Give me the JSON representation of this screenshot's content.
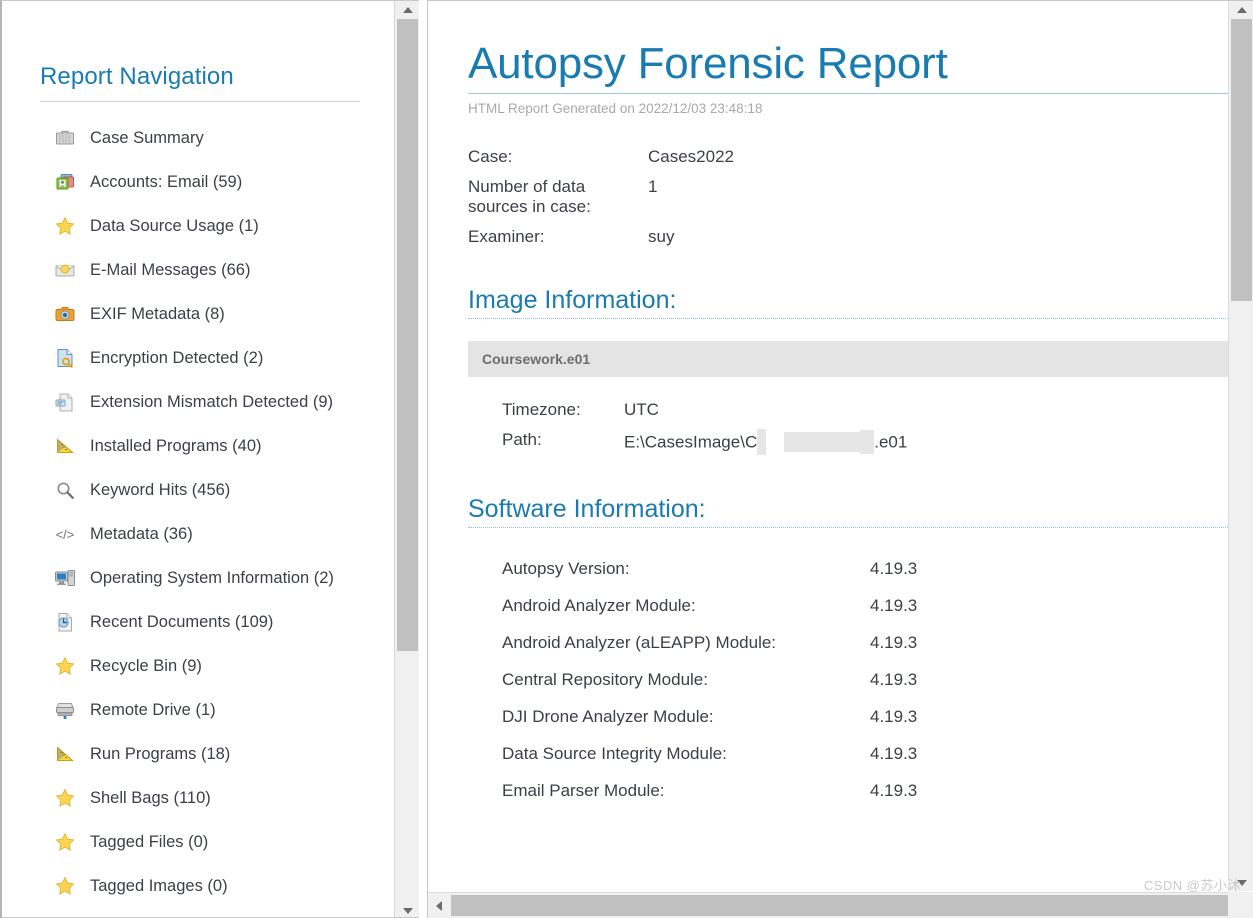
{
  "sidebar": {
    "title": "Report Navigation",
    "items": [
      {
        "label": "Case Summary",
        "icon": "briefcase-icon"
      },
      {
        "label": "Accounts: Email (59)",
        "icon": "accounts-cards-icon"
      },
      {
        "label": "Data Source Usage (1)",
        "icon": "star-icon"
      },
      {
        "label": "E-Mail Messages (66)",
        "icon": "envelope-icon"
      },
      {
        "label": "EXIF Metadata (8)",
        "icon": "camera-icon"
      },
      {
        "label": "Encryption Detected (2)",
        "icon": "document-key-icon"
      },
      {
        "label": "Extension Mismatch Detected (9)",
        "icon": "document-mismatch-icon"
      },
      {
        "label": "Installed Programs (40)",
        "icon": "ruler-triangle-icon"
      },
      {
        "label": "Keyword Hits (456)",
        "icon": "magnifier-icon"
      },
      {
        "label": "Metadata (36)",
        "icon": "code-brackets-icon"
      },
      {
        "label": "Operating System Information (2)",
        "icon": "computer-icon"
      },
      {
        "label": "Recent Documents (109)",
        "icon": "document-clock-icon"
      },
      {
        "label": "Recycle Bin (9)",
        "icon": "star-icon"
      },
      {
        "label": "Remote Drive (1)",
        "icon": "drive-icon"
      },
      {
        "label": "Run Programs (18)",
        "icon": "ruler-triangle-icon"
      },
      {
        "label": "Shell Bags (110)",
        "icon": "star-icon"
      },
      {
        "label": "Tagged Files (0)",
        "icon": "star-icon"
      },
      {
        "label": "Tagged Images (0)",
        "icon": "star-icon"
      }
    ]
  },
  "report": {
    "title": "Autopsy Forensic Report",
    "subtitle": "HTML Report Generated on 2022/12/03 23:48:18",
    "case_info": [
      {
        "key": "Case:",
        "value": "Cases2022"
      },
      {
        "key": "Number of data sources in case:",
        "value": "1"
      },
      {
        "key": "Examiner:",
        "value": "suy"
      }
    ],
    "image_section": {
      "heading": "Image Information:",
      "image_name": "Coursework.e01",
      "rows": [
        {
          "key": "Timezone:",
          "value": "UTC"
        },
        {
          "key": "Path:",
          "value_prefix": "E:\\CasesImage\\C",
          "value_suffix": ".e01",
          "redacted": true
        }
      ]
    },
    "software_section": {
      "heading": "Software Information:",
      "rows": [
        {
          "key": "Autopsy Version:",
          "value": "4.19.3"
        },
        {
          "key": "Android Analyzer Module:",
          "value": "4.19.3"
        },
        {
          "key": "Android Analyzer (aLEAPP) Module:",
          "value": "4.19.3"
        },
        {
          "key": "Central Repository Module:",
          "value": "4.19.3"
        },
        {
          "key": "DJI Drone Analyzer Module:",
          "value": "4.19.3"
        },
        {
          "key": "Data Source Integrity Module:",
          "value": "4.19.3"
        },
        {
          "key": "Email Parser Module:",
          "value": "4.19.3"
        }
      ]
    }
  },
  "watermark": "CSDN @苏小沐",
  "colors": {
    "accent_blue": "#1a7bb0",
    "text": "#3b3f46",
    "muted": "#a8a8a8",
    "header_band": "#e4e4e4",
    "scroll_thumb": "#c0c0c0"
  }
}
